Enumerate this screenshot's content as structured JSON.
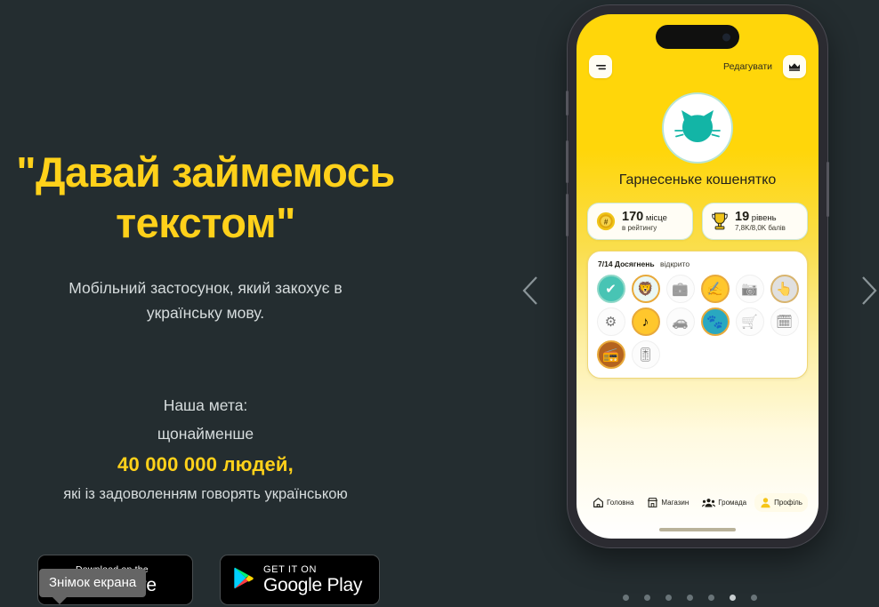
{
  "background_color": "#242d30",
  "accent_yellow": "#ffd11a",
  "hero": {
    "headline_line1": "\"Давай займемось",
    "headline_line2": "текстом\"",
    "subtitle_line1": "Мобільний застосунок, який закохує в",
    "subtitle_line2": "українську мову.",
    "goal_label": "Наша мета:",
    "goal_qualifier": "щонайменше",
    "goal_number": "40 000 000 людей,",
    "goal_tail": "які із задоволенням говорять українською"
  },
  "store_badges": {
    "appstore": {
      "small": "Download on the",
      "big": "App Store",
      "icon": "apple-icon"
    },
    "googleplay": {
      "small": "GET IT ON",
      "big": "Google Play",
      "icon": "google-play-icon"
    }
  },
  "tooltip": {
    "label": "Знімок екрана"
  },
  "carousel": {
    "prev_icon": "chevron-left-icon",
    "next_icon": "chevron-right-icon",
    "dot_count": 7,
    "active_dot": 6
  },
  "phone": {
    "header": {
      "menu_icon": "menu-icon",
      "edit_label": "Редагувати",
      "crown_icon": "crown-icon"
    },
    "avatar_icon": "cat-avatar-icon",
    "profile_name": "Гарнесеньке кошенятко",
    "stats": [
      {
        "icon": "medal-icon",
        "value": "170",
        "unit": "місце",
        "sub": "в рейтингу"
      },
      {
        "icon": "trophy-icon",
        "value": "19",
        "unit": "рівень",
        "sub": "7,8K/8,0K балів"
      }
    ],
    "achievements": {
      "count_label": "7/14 Досягнень",
      "status_label": "відкрито",
      "items": [
        {
          "name": "check-badge",
          "glyph": "✔",
          "state": "teal"
        },
        {
          "name": "lion-badge",
          "glyph": "🦁",
          "state": "lion"
        },
        {
          "name": "briefcase-badge",
          "glyph": "💼",
          "state": "locked"
        },
        {
          "name": "hand-write-badge",
          "glyph": "✍",
          "state": "unlocked"
        },
        {
          "name": "camera-badge",
          "glyph": "📷",
          "state": "locked"
        },
        {
          "name": "tap-hand-badge",
          "glyph": "👆",
          "state": "greyring"
        },
        {
          "name": "gears-badge",
          "glyph": "⚙",
          "state": "locked"
        },
        {
          "name": "music-badge",
          "glyph": "♪",
          "state": "unlocked"
        },
        {
          "name": "car-badge",
          "glyph": "🚗",
          "state": "locked"
        },
        {
          "name": "paw-badge",
          "glyph": "🐾",
          "state": "paw"
        },
        {
          "name": "cart-badge",
          "glyph": "🛒",
          "state": "locked"
        },
        {
          "name": "calendar-badge",
          "glyph": "🗓",
          "state": "locked"
        },
        {
          "name": "radio-badge",
          "glyph": "📻",
          "state": "radio"
        },
        {
          "name": "switch-badge",
          "glyph": "🎚",
          "state": "locked"
        }
      ]
    },
    "nav": [
      {
        "label": "Головна",
        "icon": "home-icon",
        "active": false
      },
      {
        "label": "Магазин",
        "icon": "store-icon",
        "active": false
      },
      {
        "label": "Громада",
        "icon": "community-icon",
        "active": false
      },
      {
        "label": "Профіль",
        "icon": "profile-icon",
        "active": true
      }
    ]
  }
}
